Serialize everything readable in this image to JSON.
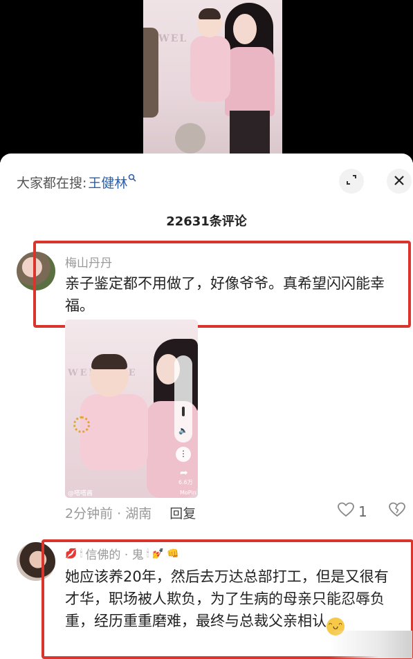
{
  "video": {
    "banner_letters": "WEL"
  },
  "sheet": {
    "search_label": "大家都在搜:",
    "search_keyword": "王健林",
    "search_icon": "search-icon",
    "expand_icon": "expand-icon",
    "close_icon": "close-icon",
    "comment_count": "22631条评论"
  },
  "comments": [
    {
      "username": "梅山丹丹",
      "text": "亲子鉴定都不用做了，好像爷爷。真希望闪闪能幸福。",
      "image": {
        "watermark": "@嗒嗒酱",
        "share_count": "6.6万",
        "logo": "MoPin",
        "banner_letters": "WELCOME"
      },
      "time_location": "2分钟前 · 湖南",
      "reply_label": "回复",
      "like_count": "1"
    },
    {
      "username": "信佛的 · 鬼",
      "text": "她应该养20年，然后去万达总部打工，但是又很有才华，职场被人欺负，为了生病的母亲只能忍辱负重，经历重重磨难，最终与总裁父亲相认",
      "emoji": "😁"
    }
  ],
  "colors": {
    "highlight_border": "#d9352d",
    "link_blue": "#2b5ea7"
  }
}
